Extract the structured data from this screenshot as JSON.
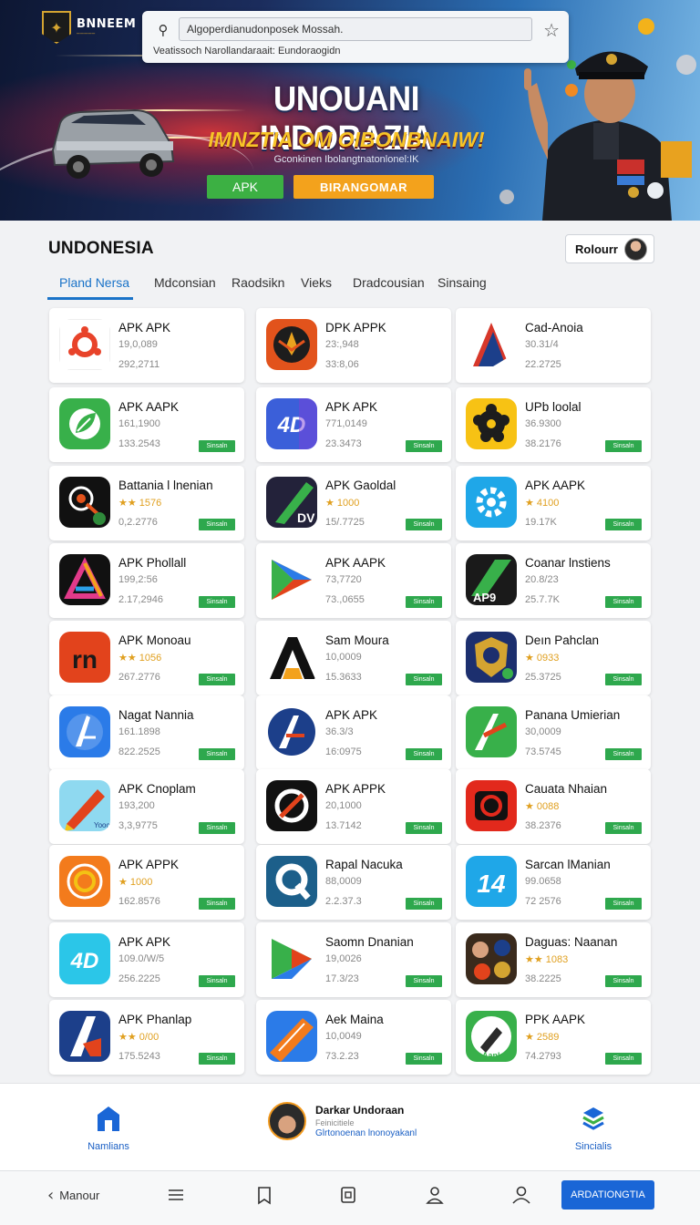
{
  "hero": {
    "brand": "BNNEEM",
    "search_value": "Algoperdianudonposek Mossah.",
    "search_sub": "Veatissoch Narollandaraait: Eundoraogidn",
    "title": "UNOUANI INDORAZIA",
    "subtitle": "IMNZTIA OM OIBONBNAIW!",
    "tagline": "Gconkinen Ibolangtnatonlonel:IK",
    "btn_apk": "APK",
    "btn_secondary": "BIRANGOMAR"
  },
  "section": {
    "title": "UNDONESIA",
    "user_label": "Rolourr"
  },
  "tabs": [
    {
      "label": "Pland Nersa",
      "active": true
    },
    {
      "label": "Mdconsian",
      "active": false
    },
    {
      "label": "Raodsikn",
      "active": false
    },
    {
      "label": "Vieks",
      "active": false
    },
    {
      "label": "Dradcousian",
      "active": false
    },
    {
      "label": "Sinsaing",
      "active": false
    }
  ],
  "apps": [
    {
      "name": "APK APK",
      "l1": "19,0,089",
      "l2": "292,2711",
      "btn": "",
      "icon": "orange-ring-icon"
    },
    {
      "name": "DPK APPK",
      "l1": "23:,948",
      "l2": "33:8,06",
      "btn": "",
      "icon": "emblem-icon"
    },
    {
      "name": "Cad-Anoia",
      "l1": "30.31/4",
      "l2": "22.2725",
      "btn": "",
      "icon": "red-a-icon"
    },
    {
      "name": "APK AAPK",
      "l1": "161,1900",
      "l2": "133.2543",
      "btn": "Sinsaln",
      "icon": "green-leaf-icon"
    },
    {
      "name": "APK APK",
      "l1": "771,0149",
      "l2": "23.3473",
      "btn": "Sinsaln",
      "icon": "4d-blue-icon"
    },
    {
      "name": "UPb loolal",
      "l1": "36.9300",
      "l2": "38.2176",
      "btn": "Sinsaln",
      "icon": "yellow-gear-icon"
    },
    {
      "name": "Battania l lnenian",
      "l1": "★★ 1576",
      "l2": "0,2.2776",
      "btn": "Sinsaln",
      "icon": "black-target-icon",
      "rated": true
    },
    {
      "name": "APK Gaoldal",
      "l1": "★ 1000",
      "l2": "15/.7725",
      "btn": "Sinsaln",
      "icon": "dv-green-icon",
      "rated": true
    },
    {
      "name": "APK AAPK",
      "l1": "★ 4100",
      "l2": "19.17K",
      "btn": "Sinsaln",
      "icon": "blue-gear-icon",
      "rated": true
    },
    {
      "name": "APK Phollall",
      "l1": "199,2:56",
      "l2": "2.17,2946",
      "btn": "Sinsaln",
      "icon": "prism-icon"
    },
    {
      "name": "APK AAPK",
      "l1": "73,7720",
      "l2": "73.,0655",
      "btn": "Sinsaln",
      "icon": "play-triangle-icon"
    },
    {
      "name": "Coanar lnstiens",
      "l1": "20.8/23",
      "l2": "25.7.7K",
      "btn": "Sinsaln",
      "icon": "ap9-icon"
    },
    {
      "name": "APK Monoau",
      "l1": "★★ 1056",
      "l2": "267.2776",
      "btn": "Sinsaln",
      "icon": "red-rn-icon",
      "rated": true
    },
    {
      "name": "Sam Moura",
      "l1": "10,0009",
      "l2": "15.3633",
      "btn": "Sinsaln",
      "icon": "black-a-icon"
    },
    {
      "name": "Deın Pahclan",
      "l1": "★ 0933",
      "l2": "25.3725",
      "btn": "Sinsaln",
      "icon": "police-badge-icon",
      "rated": true
    },
    {
      "name": "Nagat Nannia",
      "l1": "161.1898",
      "l2": "822.2525",
      "btn": "Sinsaln",
      "icon": "blue-a-icon"
    },
    {
      "name": "APK APK",
      "l1": "36.3/3",
      "l2": "16:0975",
      "btn": "Sinsaln",
      "icon": "navy-a-icon"
    },
    {
      "name": "Panana Umierian",
      "l1": "30,0009",
      "l2": "73.5745",
      "btn": "Sinsaln",
      "icon": "green-a-icon"
    },
    {
      "name": "APK Cnoplam",
      "l1": "193,200",
      "l2": "3,3,9775",
      "btn": "Sinsaln",
      "icon": "pen-icon"
    },
    {
      "name": "APK APPK",
      "l1": "20,1000",
      "l2": "13.7142",
      "btn": "Sinsaln",
      "icon": "no-sign-icon"
    },
    {
      "name": "Cauata Nhaian",
      "l1": "★ 0088",
      "l2": "38.2376",
      "btn": "Sinsaln",
      "icon": "red-camera-icon",
      "rated": true
    },
    {
      "name": "APK APPK",
      "l1": "★ 1000",
      "l2": "162.8576",
      "btn": "Sinsaln",
      "icon": "orange-swirl-icon",
      "rated": true
    },
    {
      "name": "Rapal Nacuka",
      "l1": "88,0009",
      "l2": "2.2.37.3",
      "btn": "Sinsaln",
      "icon": "q-icon"
    },
    {
      "name": "Sarcan lManian",
      "l1": "99.0658",
      "l2": "72 2576",
      "btn": "Sinsaln",
      "icon": "14-icon"
    },
    {
      "name": "APK APK",
      "l1": "109.0/W/5",
      "l2": "256.2225",
      "btn": "Sinsaln",
      "icon": "4d-cyan-icon"
    },
    {
      "name": "Saomn Dnanian",
      "l1": "19,0026",
      "l2": "17.3/23",
      "btn": "Sinsaln",
      "icon": "bird-play-icon"
    },
    {
      "name": "Daguas: Naanan",
      "l1": "★★ 1083",
      "l2": "38.2225",
      "btn": "Sinsaln",
      "icon": "collage-icon",
      "rated": true
    },
    {
      "name": "APK Phanlap",
      "l1": "★★ 0/00",
      "l2": "175.5243",
      "btn": "Sinsaln",
      "icon": "blue-red-a-icon",
      "rated": true
    },
    {
      "name": "Aek Maina",
      "l1": "10,0049",
      "l2": "73.2.23",
      "btn": "Sinsaln",
      "icon": "orange-stripe-icon"
    },
    {
      "name": "PPK AAPK",
      "l1": "★ 2589",
      "l2": "74.2793",
      "btn": "Sinsaln",
      "icon": "green-hammer-icon",
      "rated": true
    }
  ],
  "footer": {
    "left_label": "Namlians",
    "mid_title": "Darkar Undoraan",
    "mid_sub": "Feinicitiele",
    "mid_link": "Glrtonoenan lnonoyakanl",
    "right_label": "Sincialis"
  },
  "bottom_nav": {
    "back_label": "Manour",
    "cta_label": "ARDATIONGTIA"
  },
  "colors": {
    "accent": "#1a73c8",
    "install_green": "#2ea84d",
    "cta_blue": "#1a66d6",
    "hero_yellow": "#f7c427",
    "hero_orange": "#f3a21c"
  }
}
